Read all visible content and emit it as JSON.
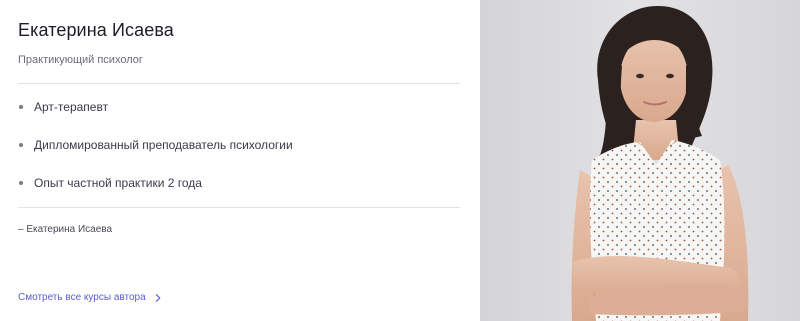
{
  "profile": {
    "name": "Екатерина Исаева",
    "role": "Практикующий психолог",
    "facts": [
      "Арт-терапевт",
      "Дипломированный преподаватель психологии",
      "Опыт частной практики 2 года"
    ],
    "signature": "– Екатерина Исаева",
    "all_courses_link": "Смотреть все курсы автора"
  },
  "colors": {
    "link": "#5b5bd6",
    "name": "#1c1c28",
    "muted": "#6b6b7a",
    "divider": "#e3e3ea",
    "photo_background": "#dcdcde"
  },
  "icons": {
    "bullet": "bullet-dot",
    "link_arrow": "chevron-right-icon"
  }
}
